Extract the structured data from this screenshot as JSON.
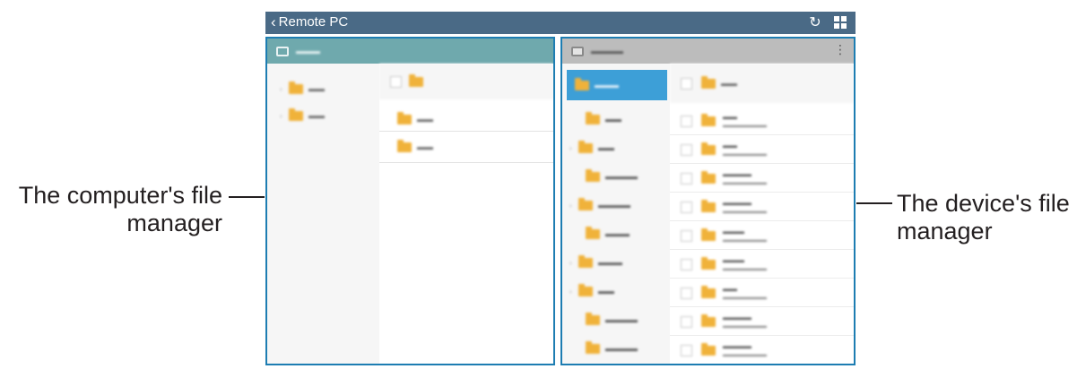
{
  "callouts": {
    "computer_line1": "The computer's file",
    "computer_line2": "manager",
    "device_line1": "The device's file",
    "device_line2": "manager"
  },
  "topbar": {
    "back_label": "Remote PC",
    "refresh_icon": "refresh-icon",
    "grid_icon": "grid-view-icon"
  },
  "colors": {
    "topbar": "#4a6a86",
    "panel_border": "#1d7db2",
    "pc_header": "#6fa9ad",
    "device_header": "#bcbcbc",
    "selected": "#3d9fd7",
    "folder": "#f0b23a"
  }
}
